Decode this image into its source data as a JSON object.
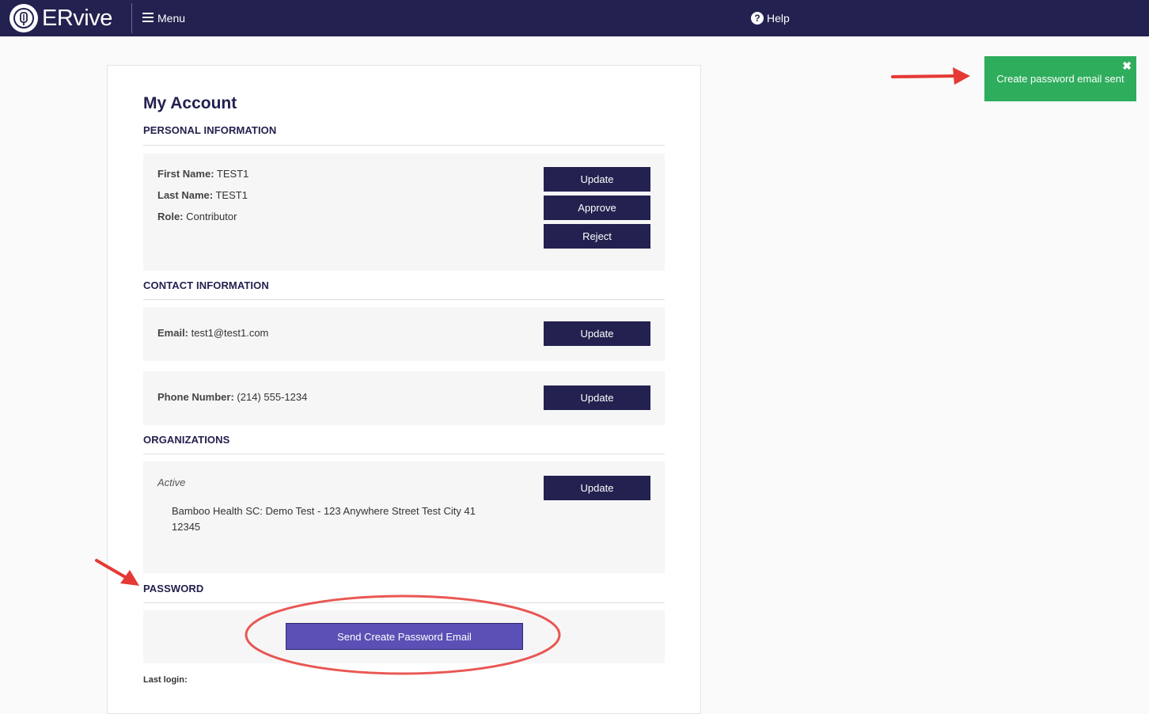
{
  "nav": {
    "brand": "ERvive",
    "menu_label": "Menu",
    "help_label": "Help"
  },
  "page": {
    "title": "My Account"
  },
  "personal": {
    "heading": "PERSONAL INFORMATION",
    "first_name_label": "First Name:",
    "first_name": "TEST1",
    "last_name_label": "Last Name:",
    "last_name": "TEST1",
    "role_label": "Role:",
    "role": "Contributor",
    "update_label": "Update",
    "approve_label": "Approve",
    "reject_label": "Reject"
  },
  "contact": {
    "heading": "CONTACT INFORMATION",
    "email_label": "Email:",
    "email": "test1@test1.com",
    "phone_label": "Phone Number:",
    "phone": "(214) 555-1234",
    "email_update_label": "Update",
    "phone_update_label": "Update"
  },
  "organizations": {
    "heading": "ORGANIZATIONS",
    "status": "Active",
    "org_line1": "Bamboo Health SC: Demo Test - 123 Anywhere Street Test City 41",
    "org_line2": "12345",
    "update_label": "Update"
  },
  "password": {
    "heading": "PASSWORD",
    "send_label": "Send Create Password Email"
  },
  "footer": {
    "last_login_label": "Last login:"
  },
  "toast": {
    "message": "Create password email sent",
    "close_glyph": "✖"
  },
  "colors": {
    "nav_bg": "#23214f",
    "primary_button": "#23214f",
    "send_button": "#5a50b5",
    "toast_bg": "#2ead5d",
    "annotation_red": "#e53935"
  }
}
